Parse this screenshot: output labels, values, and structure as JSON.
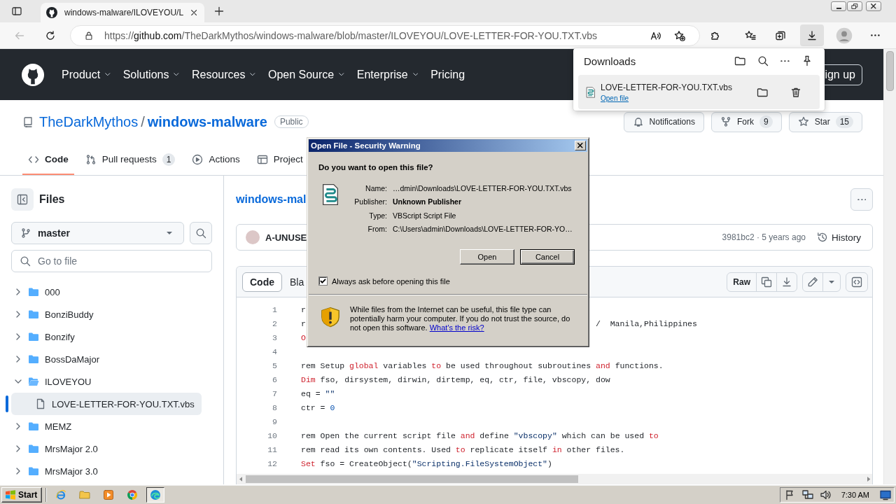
{
  "browser": {
    "tab": {
      "title": "windows-malware/ILOVEYOU/L"
    },
    "back_button": {
      "disabled": true
    },
    "address": {
      "scheme": "https://",
      "domain": "github.com",
      "path": "/TheDarkMythos/windows-malware/blob/master/ILOVEYOU/LOVE-LETTER-FOR-YOU.TXT.vbs"
    },
    "downloads_button": {
      "selected": true
    }
  },
  "downloads_panel": {
    "title": "Downloads",
    "items": [
      {
        "filename": "LOVE-LETTER-FOR-YOU.TXT.vbs",
        "action": "Open file"
      }
    ]
  },
  "site_header": {
    "nav": [
      {
        "label": "Product",
        "dropdown": true
      },
      {
        "label": "Solutions",
        "dropdown": true
      },
      {
        "label": "Resources",
        "dropdown": true
      },
      {
        "label": "Open Source",
        "dropdown": true
      },
      {
        "label": "Enterprise",
        "dropdown": true
      },
      {
        "label": "Pricing",
        "dropdown": false
      }
    ],
    "sign_up": "ign up"
  },
  "repo": {
    "owner": "TheDarkMythos",
    "separator": "/",
    "name": "windows-malware",
    "visibility": "Public",
    "actions": [
      {
        "kind": "notifications",
        "label": "Notifications"
      },
      {
        "kind": "fork",
        "label": "Fork",
        "count": "9"
      },
      {
        "kind": "star",
        "label": "Star",
        "count": "15"
      }
    ]
  },
  "repo_tabs": [
    {
      "kind": "code",
      "label": "Code",
      "selected": true
    },
    {
      "kind": "pulls",
      "label": "Pull requests",
      "count": "1",
      "selected": false
    },
    {
      "kind": "actions",
      "label": "Actions",
      "selected": false
    },
    {
      "kind": "projects",
      "label": "Project",
      "selected": false
    }
  ],
  "sidebar": {
    "title": "Files",
    "branch": "master",
    "search": {
      "placeholder": "Go to file"
    },
    "tree": [
      {
        "kind": "folder",
        "name": "000",
        "expanded": false,
        "selected": false
      },
      {
        "kind": "folder",
        "name": "BonziBuddy",
        "expanded": false,
        "selected": false
      },
      {
        "kind": "folder",
        "name": "Bonzify",
        "expanded": false,
        "selected": false
      },
      {
        "kind": "folder",
        "name": "BossDaMajor",
        "expanded": false,
        "selected": false
      },
      {
        "kind": "folder",
        "name": "ILOVEYOU",
        "expanded": true,
        "selected": false,
        "children": [
          {
            "kind": "file",
            "name": "LOVE-LETTER-FOR-YOU.TXT.vbs",
            "selected": true
          }
        ]
      },
      {
        "kind": "folder",
        "name": "MEMZ",
        "expanded": false,
        "selected": false
      },
      {
        "kind": "folder",
        "name": "MrsMajor 2.0",
        "expanded": false,
        "selected": false
      },
      {
        "kind": "folder",
        "name": "MrsMajor 3.0",
        "expanded": false,
        "selected": false
      }
    ]
  },
  "file_view": {
    "breadcrumb": "windows-mal",
    "commit": {
      "author": "A-UNUSE",
      "meta": "3981bc2 · 5 years ago",
      "history": "History"
    },
    "view_tabs": [
      {
        "label": "Code",
        "selected": true
      },
      {
        "label": "Bla",
        "selected": false
      }
    ],
    "raw": "Raw",
    "lines": [
      {
        "number": "1",
        "tokens": [
          {
            "text": "r",
            "kind": "plain"
          }
        ]
      },
      {
        "number": "2",
        "tokens": [
          {
            "text": "r",
            "kind": "plain"
          }
        ],
        "tail": [
          {
            "text": "/  Manila,Philippines",
            "kind": "plain"
          }
        ]
      },
      {
        "number": "3",
        "tokens": [
          {
            "text": "O",
            "kind": "keyword"
          }
        ]
      },
      {
        "number": "4"
      },
      {
        "number": "5",
        "tokens": [
          {
            "text": "rem Setup ",
            "kind": "plain"
          },
          {
            "text": "global",
            "kind": "keyword"
          },
          {
            "text": " variables ",
            "kind": "plain"
          },
          {
            "text": "to",
            "kind": "keyword"
          },
          {
            "text": " be used throughout subroutines ",
            "kind": "plain"
          },
          {
            "text": "and",
            "kind": "keyword"
          },
          {
            "text": " functions.",
            "kind": "plain"
          }
        ]
      },
      {
        "number": "6",
        "tokens": [
          {
            "text": "Dim",
            "kind": "keyword"
          },
          {
            "text": " fso, dirsystem, dirwin, dirtemp, eq, ctr, file, vbscopy, dow",
            "kind": "plain"
          }
        ]
      },
      {
        "number": "7",
        "tokens": [
          {
            "text": "eq = ",
            "kind": "plain"
          },
          {
            "text": "\"\"",
            "kind": "string"
          }
        ]
      },
      {
        "number": "8",
        "tokens": [
          {
            "text": "ctr = ",
            "kind": "plain"
          },
          {
            "text": "0",
            "kind": "number"
          }
        ]
      },
      {
        "number": "9"
      },
      {
        "number": "10",
        "tokens": [
          {
            "text": "rem Open the current script file ",
            "kind": "plain"
          },
          {
            "text": "and",
            "kind": "keyword"
          },
          {
            "text": " define ",
            "kind": "plain"
          },
          {
            "text": "\"vbscopy\"",
            "kind": "string"
          },
          {
            "text": " which can be used ",
            "kind": "plain"
          },
          {
            "text": "to",
            "kind": "keyword"
          }
        ]
      },
      {
        "number": "11",
        "tokens": [
          {
            "text": "rem read its own contents. Used ",
            "kind": "plain"
          },
          {
            "text": "to",
            "kind": "keyword"
          },
          {
            "text": " replicate itself ",
            "kind": "plain"
          },
          {
            "text": "in",
            "kind": "keyword"
          },
          {
            "text": " other files.",
            "kind": "plain"
          }
        ]
      },
      {
        "number": "12",
        "tokens": [
          {
            "text": "Set",
            "kind": "keyword"
          },
          {
            "text": " fso = CreateObject(",
            "kind": "plain"
          },
          {
            "text": "\"Scripting.FileSystemObject\"",
            "kind": "string"
          },
          {
            "text": ")",
            "kind": "plain"
          }
        ]
      }
    ]
  },
  "dialog": {
    "title": "Open File - Security Warning",
    "question": "Do you want to open this file?",
    "fields": [
      {
        "label": "Name:",
        "value": "…dmin\\Downloads\\LOVE-LETTER-FOR-YOU.TXT.vbs",
        "bold": false
      },
      {
        "label": "Publisher:",
        "value": "Unknown Publisher",
        "bold": true
      },
      {
        "label": "Type:",
        "value": "VBScript Script File",
        "bold": false
      },
      {
        "label": "From:",
        "value": "C:\\Users\\admin\\Downloads\\LOVE-LETTER-FOR-YO…",
        "bold": false
      }
    ],
    "buttons": [
      {
        "label": "Open",
        "default": false
      },
      {
        "label": "Cancel",
        "default": true
      }
    ],
    "checkbox": {
      "label": "Always ask before opening this file",
      "checked": true
    },
    "warning": {
      "text": "While files from the Internet can be useful, this file type can potentially harm your computer. If you do not trust the source, do not open this software.",
      "link": "What's the risk?"
    }
  },
  "taskbar": {
    "start": "Start",
    "apps": [
      {
        "kind": "ie",
        "selected": false
      },
      {
        "kind": "explorer",
        "selected": false
      },
      {
        "kind": "media",
        "selected": false
      },
      {
        "kind": "chrome",
        "selected": false
      },
      {
        "kind": "edge",
        "selected": true
      }
    ],
    "clock": "7:30 AM"
  }
}
